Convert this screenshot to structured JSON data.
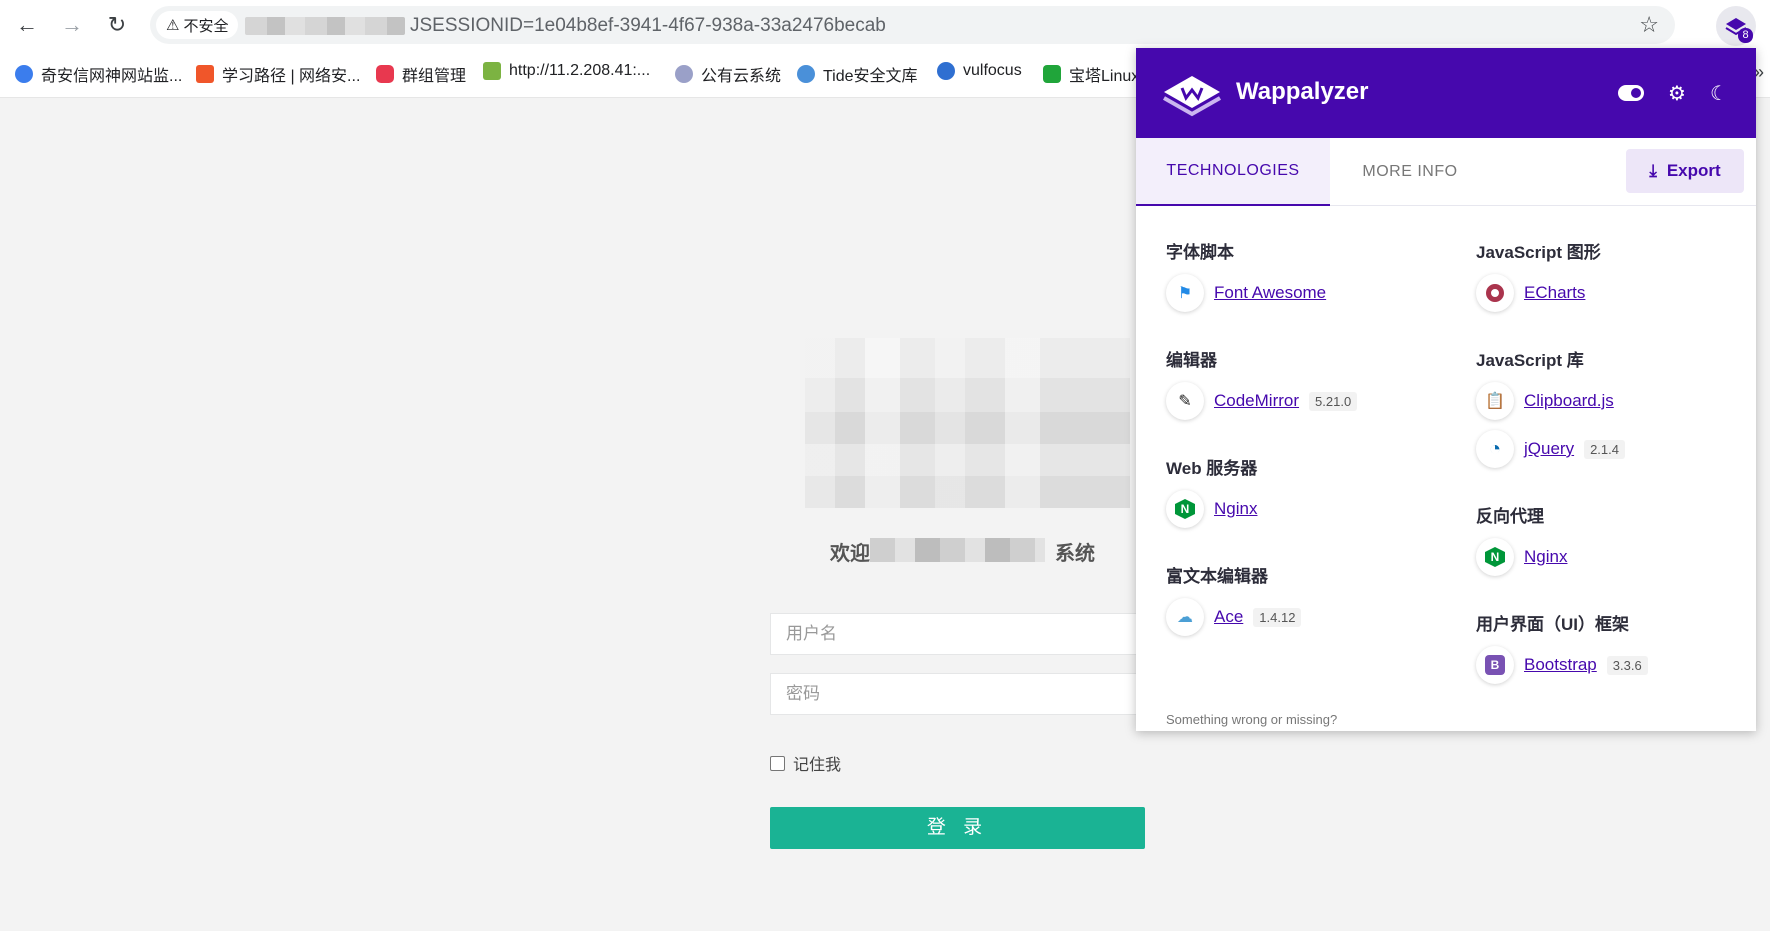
{
  "browser": {
    "security_label": "不安全",
    "url": "JSESSIONID=1e04b8ef-3941-4f67-938a-33a2476becab",
    "extension_badge": "8"
  },
  "bookmarks": [
    {
      "label": "奇安信网神网站监...",
      "color": "#3b7ded"
    },
    {
      "label": "学习路径 | 网络安...",
      "color": "#f0562a"
    },
    {
      "label": "群组管理",
      "color": "#e8384f"
    },
    {
      "label": "http://11.2.208.41:...",
      "color": "#7cb342"
    },
    {
      "label": "公有云系统",
      "color": "#9aa0c8"
    },
    {
      "label": "Tide安全文库",
      "color": "#4a90d9"
    },
    {
      "label": "vulfocus",
      "color": "#2f6fd1"
    },
    {
      "label": "宝塔Linux",
      "color": "#20a53a"
    }
  ],
  "login": {
    "welcome_prefix": "欢迎",
    "welcome_suffix": "系统",
    "username_placeholder": "用户名",
    "password_placeholder": "密码",
    "remember_label": "记住我",
    "submit_label": "登 录"
  },
  "wappalyzer": {
    "title": "Wappalyzer",
    "tabs": {
      "technologies": "TECHNOLOGIES",
      "more_info": "MORE INFO"
    },
    "export_label": "Export",
    "left_column": [
      {
        "category": "字体脚本",
        "items": [
          {
            "name": "Font Awesome",
            "version": "",
            "icon": "flag-icon",
            "color": "#228ae6"
          }
        ]
      },
      {
        "category": "编辑器",
        "items": [
          {
            "name": "CodeMirror",
            "version": "5.21.0",
            "icon": "codemirror-icon",
            "color": "#222222"
          }
        ]
      },
      {
        "category": "Web 服务器",
        "items": [
          {
            "name": "Nginx",
            "version": "",
            "icon": "nginx-icon",
            "color": "#009639"
          }
        ]
      },
      {
        "category": "富文本编辑器",
        "items": [
          {
            "name": "Ace",
            "version": "1.4.12",
            "icon": "ace-cloud-icon",
            "color": "#4b9fd5"
          }
        ]
      }
    ],
    "right_column": [
      {
        "category": "JavaScript 图形",
        "items": [
          {
            "name": "ECharts",
            "version": "",
            "icon": "echarts-icon",
            "color": "#aa344d"
          }
        ]
      },
      {
        "category": "JavaScript 库",
        "items": [
          {
            "name": "Clipboard.js",
            "version": "",
            "icon": "clipboard-icon",
            "color": "#1bb5a0"
          },
          {
            "name": "jQuery",
            "version": "2.1.4",
            "icon": "jquery-icon",
            "color": "#0769ad"
          }
        ]
      },
      {
        "category": "反向代理",
        "items": [
          {
            "name": "Nginx",
            "version": "",
            "icon": "nginx-icon",
            "color": "#009639"
          }
        ]
      },
      {
        "category": "用户界面（UI）框架",
        "items": [
          {
            "name": "Bootstrap",
            "version": "3.3.6",
            "icon": "bootstrap-icon",
            "color": "#7952b3"
          }
        ]
      }
    ],
    "footer": "Something wrong or missing?"
  }
}
